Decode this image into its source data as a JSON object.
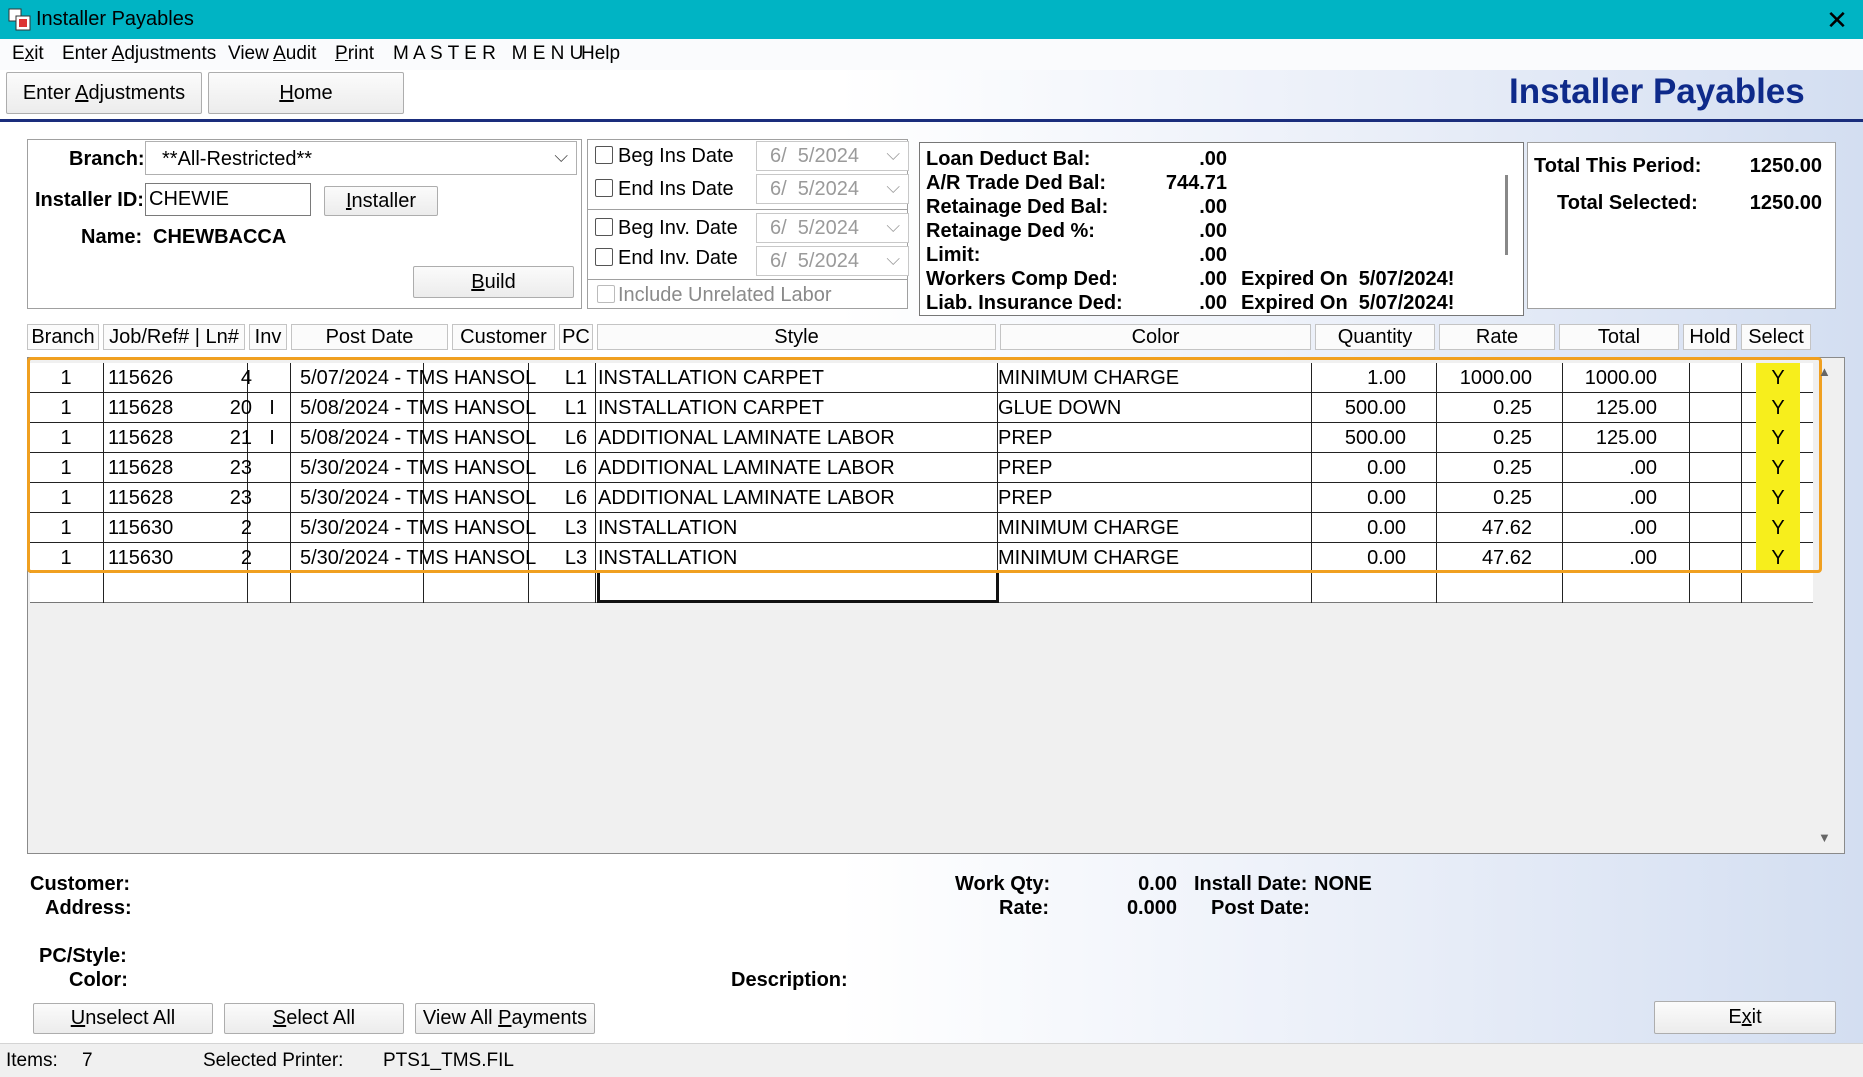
{
  "window": {
    "title": "Installer Payables",
    "close": "✕"
  },
  "menu": [
    "Exit",
    "Enter Adjustments",
    "View Audit",
    "Print",
    "M A S T E R   M E N U",
    "Help"
  ],
  "toolbar": {
    "enter_adjustments": "Enter Adjustments",
    "home": "Home"
  },
  "header_title": "Installer Payables",
  "filters": {
    "branch_label": "Branch:",
    "branch_value": "**All-Restricted**",
    "installer_id_label": "Installer ID:",
    "installer_id_value": "CHEWIE",
    "installer_button": "Installer",
    "name_label": "Name:",
    "name_value": "CHEWBACCA",
    "build_button": "Build"
  },
  "dates": {
    "beg_ins_label": "Beg Ins Date",
    "beg_ins_value": "6/  5/2024",
    "end_ins_label": "End Ins Date",
    "end_ins_value": "6/  5/2024",
    "beg_inv_label": "Beg Inv. Date",
    "beg_inv_value": "6/  5/2024",
    "end_inv_label": "End Inv. Date",
    "end_inv_value": "6/  5/2024",
    "include_unrelated": "Include Unrelated Labor"
  },
  "balances": {
    "loan_label": "Loan Deduct Bal:",
    "loan_value": ".00",
    "ar_label": "A/R Trade Ded Bal:",
    "ar_value": "744.71",
    "ret_bal_label": "Retainage Ded Bal:",
    "ret_bal_value": ".00",
    "ret_pct_label": "Retainage Ded %:",
    "ret_pct_value": ".00",
    "limit_label": "Limit:",
    "limit_value": ".00",
    "wc_label": "Workers Comp Ded:",
    "wc_value": ".00",
    "wc_expired": "Expired On  5/07/2024!",
    "liab_label": "Liab. Insurance Ded:",
    "liab_value": ".00",
    "liab_expired": "Expired On  5/07/2024!"
  },
  "totals": {
    "period_label": "Total This Period:",
    "period_value": "1250.00",
    "selected_label": "Total Selected:",
    "selected_value": "1250.00"
  },
  "columns": [
    "Branch",
    "Job/Ref# | Ln#",
    "Inv",
    "Post Date",
    "Customer",
    "PC",
    "Style",
    "Color",
    "Quantity",
    "Rate",
    "Total",
    "Hold",
    "Select"
  ],
  "rows": [
    {
      "branch": "1",
      "job": "115626",
      "ln": "4",
      "inv": "",
      "post_date": "5/07/2024 - TMS",
      "customer": "HANSOL",
      "pc": "L1",
      "style": "INSTALLATION CARPET",
      "color": "MINIMUM CHARGE",
      "qty": "1.00",
      "rate": "1000.00",
      "total": "1000.00",
      "hold": "",
      "select": "Y"
    },
    {
      "branch": "1",
      "job": "115628",
      "ln": "20",
      "inv": "I",
      "post_date": "5/08/2024 - TMS",
      "customer": "HANSOL",
      "pc": "L1",
      "style": "INSTALLATION CARPET",
      "color": "GLUE DOWN",
      "qty": "500.00",
      "rate": "0.25",
      "total": "125.00",
      "hold": "",
      "select": "Y"
    },
    {
      "branch": "1",
      "job": "115628",
      "ln": "21",
      "inv": "I",
      "post_date": "5/08/2024 - TMS",
      "customer": "HANSOL",
      "pc": "L6",
      "style": "ADDITIONAL LAMINATE LABOR",
      "color": "PREP",
      "qty": "500.00",
      "rate": "0.25",
      "total": "125.00",
      "hold": "",
      "select": "Y"
    },
    {
      "branch": "1",
      "job": "115628",
      "ln": "23",
      "inv": "",
      "post_date": "5/30/2024 - TMS",
      "customer": "HANSOL",
      "pc": "L6",
      "style": "ADDITIONAL LAMINATE LABOR",
      "color": "PREP",
      "qty": "0.00",
      "rate": "0.25",
      "total": ".00",
      "hold": "",
      "select": "Y"
    },
    {
      "branch": "1",
      "job": "115628",
      "ln": "23",
      "inv": "",
      "post_date": "5/30/2024 - TMS",
      "customer": "HANSOL",
      "pc": "L6",
      "style": "ADDITIONAL LAMINATE LABOR",
      "color": "PREP",
      "qty": "0.00",
      "rate": "0.25",
      "total": ".00",
      "hold": "",
      "select": "Y"
    },
    {
      "branch": "1",
      "job": "115630",
      "ln": "2",
      "inv": "",
      "post_date": "5/30/2024 - TMS",
      "customer": "HANSOL",
      "pc": "L3",
      "style": "INSTALLATION",
      "color": "MINIMUM CHARGE",
      "qty": "0.00",
      "rate": "47.62",
      "total": ".00",
      "hold": "",
      "select": "Y"
    },
    {
      "branch": "1",
      "job": "115630",
      "ln": "2",
      "inv": "",
      "post_date": "5/30/2024 - TMS",
      "customer": "HANSOL",
      "pc": "L3",
      "style": "INSTALLATION",
      "color": "MINIMUM CHARGE",
      "qty": "0.00",
      "rate": "47.62",
      "total": ".00",
      "hold": "",
      "select": "Y"
    }
  ],
  "details": {
    "customer_label": "Customer:",
    "address_label": "Address:",
    "pcstyle_label": "PC/Style:",
    "color_label": "Color:",
    "workqty_label": "Work Qty:",
    "workqty_value": "0.00",
    "rate_label": "Rate:",
    "rate_value": "0.000",
    "install_date_label": "Install Date:",
    "install_date_value": "NONE",
    "post_date_label": "Post Date:",
    "description_label": "Description:"
  },
  "bottom_buttons": {
    "unselect_all": "Unselect All",
    "select_all": "Select All",
    "view_all_payments": "View All Payments",
    "exit": "Exit"
  },
  "status": {
    "items_label": "Items:",
    "items_value": "7",
    "printer_label": "Selected Printer:",
    "printer_value": "PTS1_TMS.FIL"
  },
  "colors": {
    "titlebar": "#00b4c4",
    "header_title": "#0e2a8a",
    "select_highlight": "#f7ee1c",
    "row_outline": "#f0a020"
  }
}
